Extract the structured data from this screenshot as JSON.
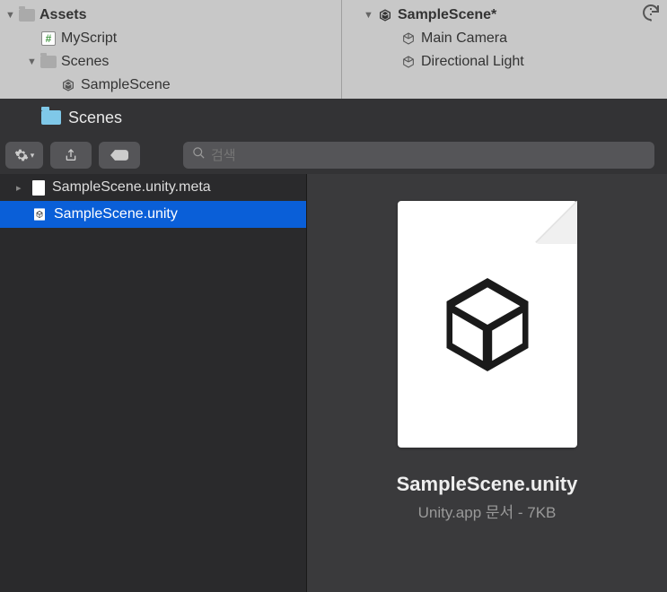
{
  "unity": {
    "project": {
      "root": "Assets",
      "items": [
        {
          "label": "MyScript",
          "type": "script"
        },
        {
          "label": "Scenes",
          "type": "folder",
          "children": [
            {
              "label": "SampleScene",
              "type": "scene"
            }
          ]
        }
      ]
    },
    "hierarchy": {
      "scene": "SampleScene*",
      "objects": [
        {
          "label": "Main Camera"
        },
        {
          "label": "Directional Light"
        }
      ]
    }
  },
  "finder": {
    "title": "Scenes",
    "search_placeholder": "검색",
    "files": [
      {
        "name": "SampleScene.unity.meta",
        "selected": false,
        "type": "meta"
      },
      {
        "name": "SampleScene.unity",
        "selected": true,
        "type": "unity"
      }
    ],
    "preview": {
      "name": "SampleScene.unity",
      "meta": "Unity.app 문서 - 7KB"
    }
  }
}
